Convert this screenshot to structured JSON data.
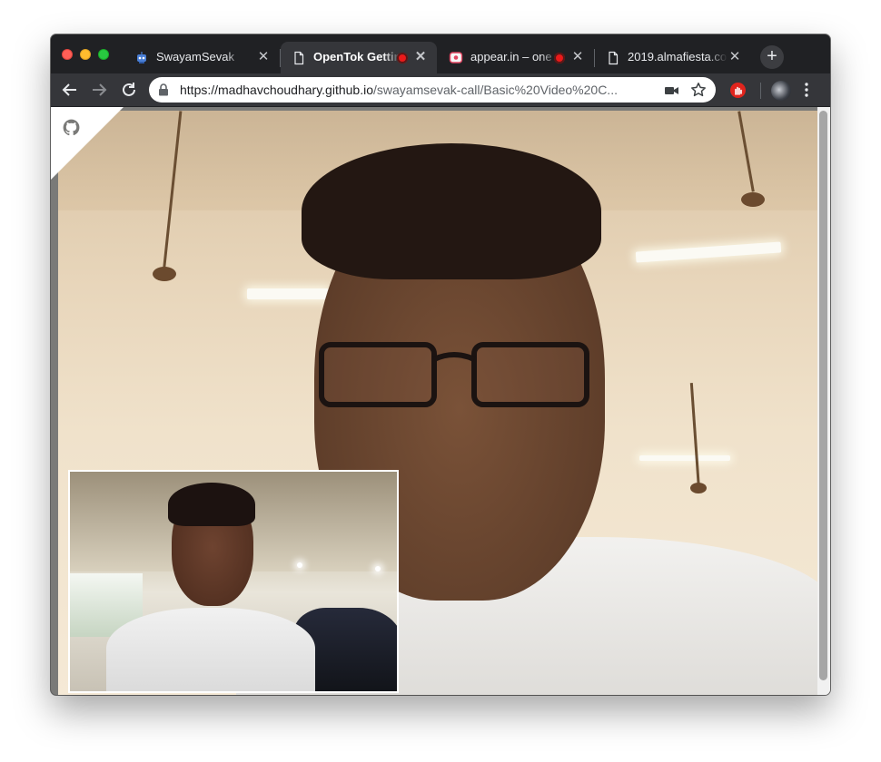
{
  "browser": {
    "tabs": [
      {
        "title": "SwayamSevak",
        "icon": "robot-favicon-icon",
        "active": false,
        "recording": false
      },
      {
        "title": "OpenTok Gettin",
        "icon": "page-icon",
        "active": true,
        "recording": true
      },
      {
        "title": "appear.in – one",
        "icon": "appear-in-favicon-icon",
        "active": false,
        "recording": true
      },
      {
        "title": "2019.almafiesta.co",
        "icon": "page-icon",
        "active": false,
        "recording": false
      }
    ],
    "tab_close_glyph": "✕",
    "new_tab_glyph": "+",
    "address": {
      "host": "https://madhavchoudhary.github.io",
      "path": "/swayamsevak-call/Basic%20Video%20C..."
    }
  },
  "colors": {
    "recording": "#ea1a1a",
    "tabstrip": "#202124",
    "toolbar": "#35363a"
  },
  "icons": {
    "back": "arrow-left-icon",
    "forward": "arrow-right-icon",
    "reload": "reload-icon",
    "lock": "lock-icon",
    "camera": "video-camera-icon",
    "bookmark": "star-icon",
    "menu": "three-dots-icon",
    "github": "github-octocat-icon"
  },
  "page": {
    "remote_video": "remote participant video stream",
    "local_video": "local publisher video preview"
  }
}
